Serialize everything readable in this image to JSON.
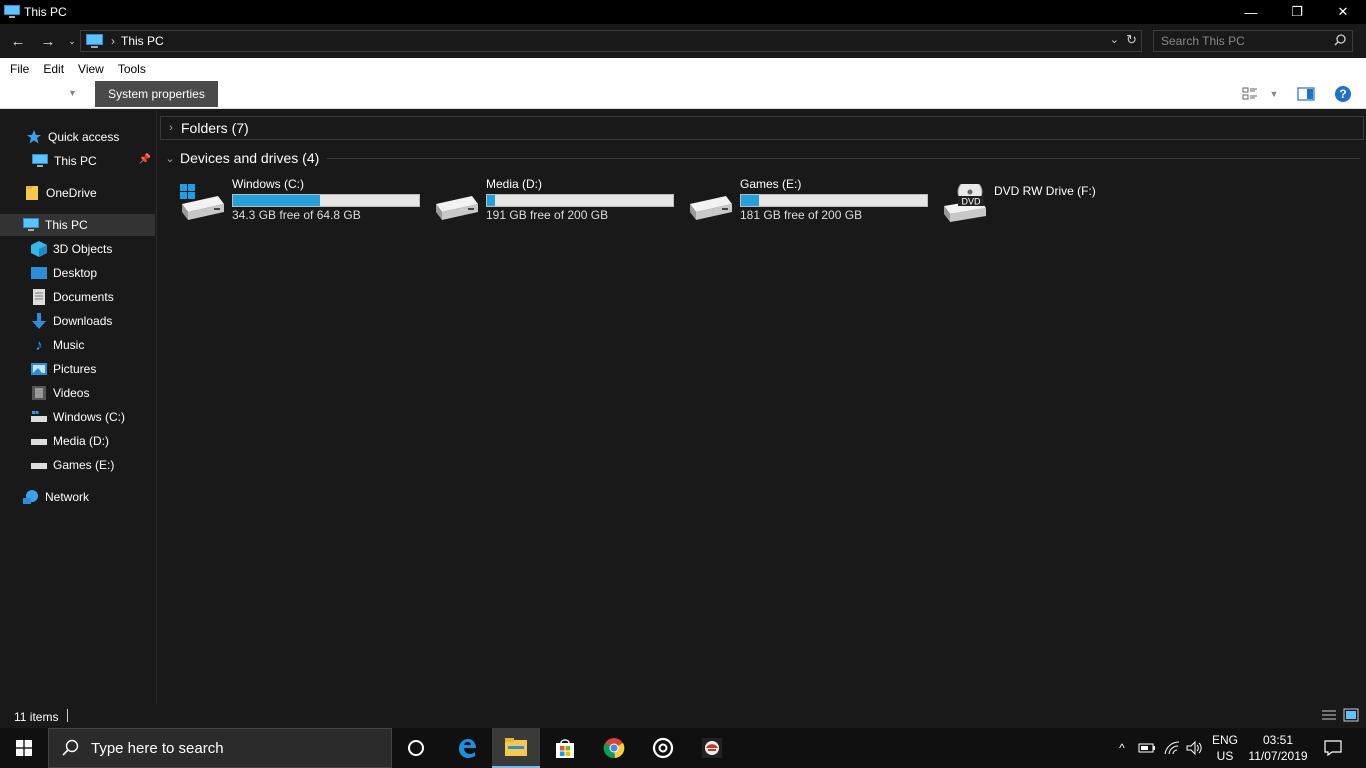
{
  "window": {
    "title": "This PC",
    "controls": {
      "minimize": "—",
      "restore": "❐",
      "close": "✕"
    }
  },
  "address": {
    "crumb": "This PC",
    "search_placeholder": "Search This PC"
  },
  "menu": [
    "File",
    "Edit",
    "View",
    "Tools"
  ],
  "toolbar": {
    "system_properties": "System properties"
  },
  "sidebar": {
    "items": [
      {
        "label": "Quick access",
        "icon": "star-icon"
      },
      {
        "label": "This PC",
        "icon": "monitor-icon",
        "pinned": true
      },
      {
        "label": "OneDrive",
        "icon": "folder-icon"
      },
      {
        "label": "This PC",
        "icon": "monitor-icon",
        "selected": true
      },
      {
        "label": "3D Objects",
        "icon": "cube-icon"
      },
      {
        "label": "Desktop",
        "icon": "desktop-icon"
      },
      {
        "label": "Documents",
        "icon": "document-icon"
      },
      {
        "label": "Downloads",
        "icon": "download-icon"
      },
      {
        "label": "Music",
        "icon": "music-icon"
      },
      {
        "label": "Pictures",
        "icon": "picture-icon"
      },
      {
        "label": "Videos",
        "icon": "video-icon"
      },
      {
        "label": "Windows (C:)",
        "icon": "drive-icon"
      },
      {
        "label": "Media (D:)",
        "icon": "drive-icon"
      },
      {
        "label": "Games (E:)",
        "icon": "drive-icon"
      },
      {
        "label": "Network",
        "icon": "network-icon"
      }
    ]
  },
  "content": {
    "folders_header": "Folders (7)",
    "devices_header": "Devices and drives (4)",
    "drives": [
      {
        "name": "Windows (C:)",
        "free": "34.3 GB free of 64.8 GB",
        "used_fraction": 0.47,
        "windows_logo": true
      },
      {
        "name": "Media (D:)",
        "free": "191 GB free of 200 GB",
        "used_fraction": 0.045
      },
      {
        "name": "Games (E:)",
        "free": "181 GB free of 200 GB",
        "used_fraction": 0.095
      },
      {
        "name": "DVD RW Drive (F:)",
        "optical": true,
        "optical_label": "DVD"
      }
    ]
  },
  "status": {
    "count": "11 items"
  },
  "taskbar": {
    "search_placeholder": "Type here to search",
    "lang_top": "ENG",
    "lang_bottom": "US",
    "time": "03:51",
    "date": "11/07/2019"
  },
  "colors": {
    "accent": "#26a0da",
    "selection": "#333333",
    "background": "#191919"
  }
}
